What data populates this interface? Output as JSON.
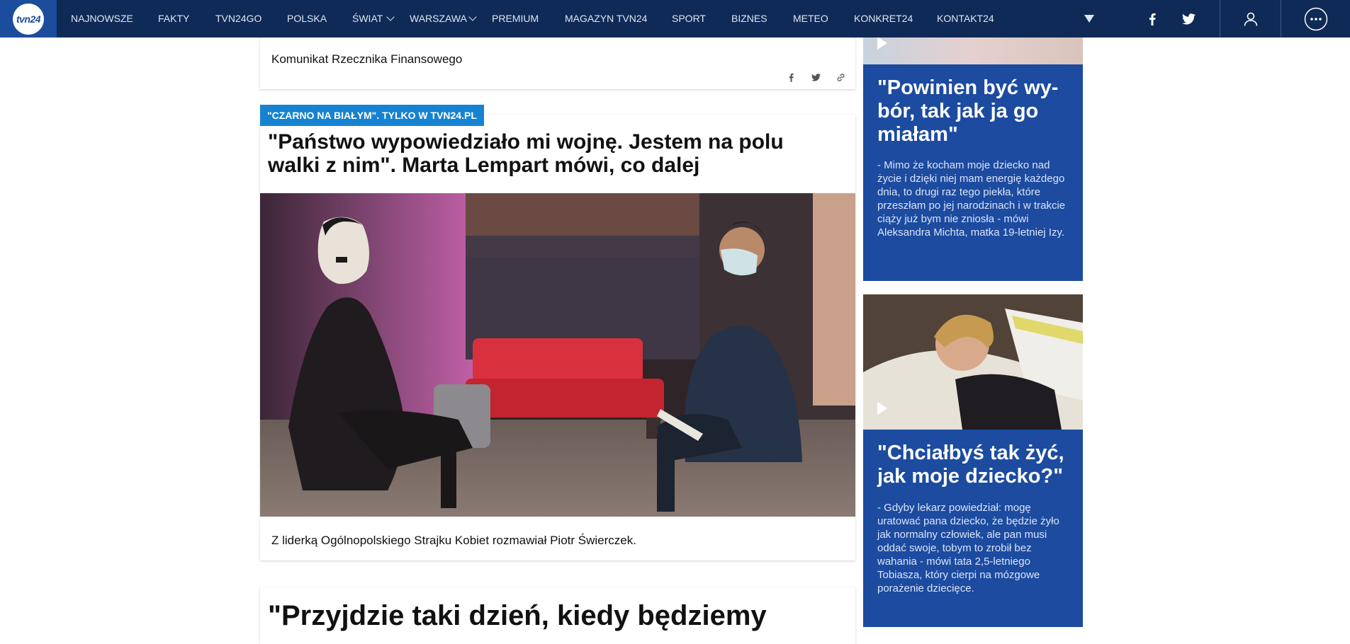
{
  "nav": {
    "logo_text": "tvn24",
    "items": [
      {
        "label": "NAJNOWSZE"
      },
      {
        "label": "FAKTY"
      },
      {
        "label": "TVN24GO"
      },
      {
        "label": "POLSKA"
      },
      {
        "label": "ŚWIAT",
        "dropdown": true
      },
      {
        "label": "WARSZAWA",
        "dropdown": true
      },
      {
        "label": "PREMIUM"
      },
      {
        "label": "MAGAZYN TVN24"
      },
      {
        "label": "SPORT"
      },
      {
        "label": "BIZNES"
      },
      {
        "label": "METEO"
      },
      {
        "label": "KONKRET24"
      },
      {
        "label": "KONTAKT24"
      }
    ],
    "icons": [
      "dropdown-triangle-icon",
      "facebook-icon",
      "twitter-icon",
      "user-icon",
      "more-icon"
    ]
  },
  "main": {
    "top_card": {
      "text": "Komunikat Rzecznika Finansowego",
      "share_icons": [
        "facebook-icon",
        "twitter-icon",
        "link-icon"
      ]
    },
    "article": {
      "tag": "\"CZARNO NA BIAŁYM\". TYLKO W TVN24.PL",
      "title": "\"Państwo wypowiedziało mi wojnę. Jestem na polu walki z nim\". Marta Lempart mówi, co dalej",
      "caption": "Z liderką Ogólnopolskiego Strajku Kobiet rozmawiał Piotr Świerczek."
    },
    "next_article": {
      "title": "\"Przyjdzie taki dzień, kiedy będziemy"
    }
  },
  "sidebar": {
    "card1": {
      "title": "\"Powinien być wy-bór, tak jak ja go miałam\"",
      "text": "- Mimo że kocham moje dziecko nad życie i dzięki niej mam energię każdego dnia, to drugi raz tego piekła, które przeszłam po jej narodzinach i w trakcie ciąży już bym nie zniosła - mówi Aleksandra Michta, matka 19-letniej Izy."
    },
    "card2": {
      "title": "\"Chciałbyś tak żyć, jak moje dziecko?\"",
      "text": "- Gdyby lekarz powiedział: mogę uratować pana dziecko, że będzie żyło jak normalny człowiek, ale pan musi oddać swoje, tobym to zrobił bez wahania - mówi tata 2,5-letniego Tobiasza, który cierpi na mózgowe porażenie dziecięce."
    }
  },
  "colors": {
    "nav_bg": "#0f2a56",
    "logo_bg": "#1c4c9c",
    "tag_bg": "#1583d1",
    "sidebar_card_bg": "#1c4ba0"
  }
}
